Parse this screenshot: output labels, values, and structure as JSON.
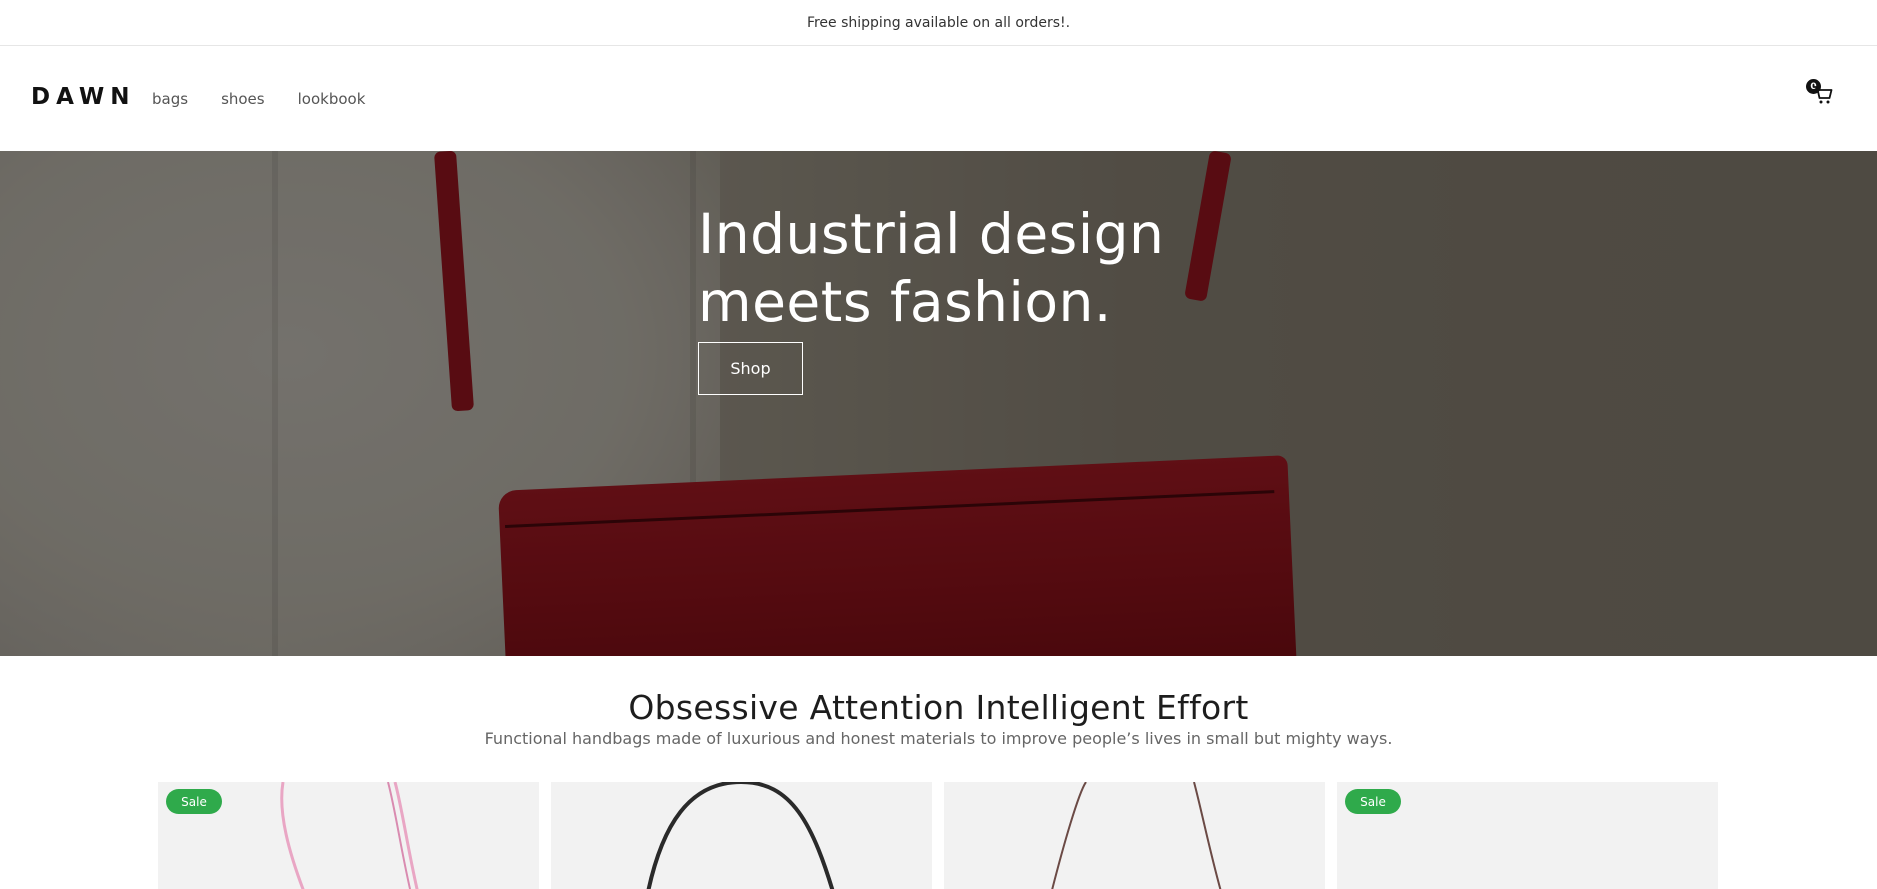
{
  "announcement": {
    "text": "Free shipping available on all orders!."
  },
  "header": {
    "logo": "DAWN",
    "nav": [
      {
        "label": "bags"
      },
      {
        "label": "shoes"
      },
      {
        "label": "lookbook"
      }
    ],
    "cart": {
      "count": "0",
      "icon": "cart-icon"
    }
  },
  "hero": {
    "title_line1": "Industrial design",
    "title_line2": "meets fashion.",
    "button_label": "Shop"
  },
  "rich_text": {
    "title": "Obsessive Attention Intelligent Effort",
    "subtitle": "Functional handbags made of luxurious and honest materials to improve people’s lives in small but mighty ways."
  },
  "products": [
    {
      "badge": "Sale",
      "bag_color": "#e9a6c4"
    },
    {
      "badge": "",
      "bag_color": "#2a2a2a"
    },
    {
      "badge": "",
      "bag_color": "#6b4a45"
    },
    {
      "badge": "Sale",
      "bag_color": ""
    }
  ],
  "colors": {
    "sale_badge": "#2faa4b",
    "hero_bag": "#c8202c",
    "card_bg": "#f2f2f2"
  }
}
